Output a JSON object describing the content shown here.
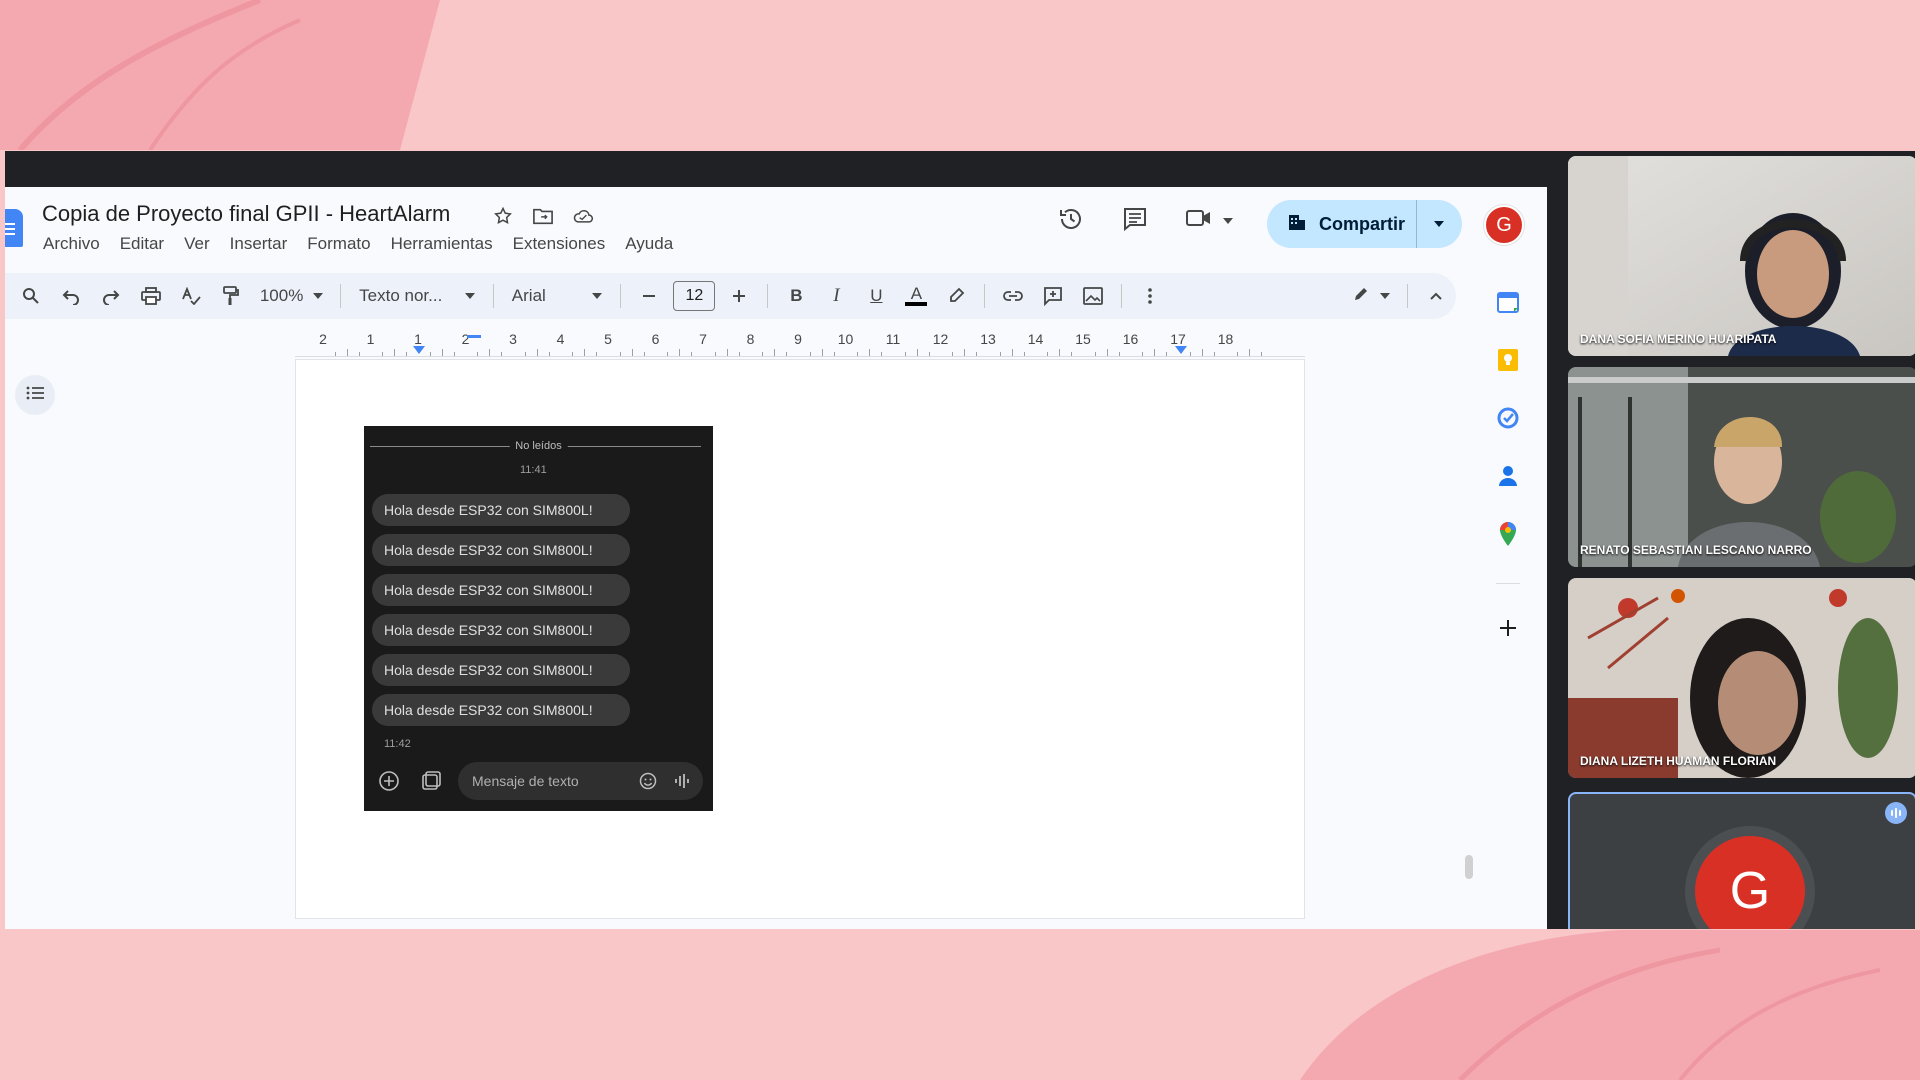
{
  "document": {
    "title": "Copia de Proyecto final GPII - HeartAlarm",
    "menu": [
      "Archivo",
      "Editar",
      "Ver",
      "Insertar",
      "Formato",
      "Herramientas",
      "Extensiones",
      "Ayuda"
    ],
    "share_label": "Compartir",
    "account_initial": "G"
  },
  "toolbar": {
    "zoom": "100%",
    "style": "Texto nor...",
    "font": "Arial",
    "font_size": "12",
    "bold": "B",
    "italic": "I",
    "underline": "U",
    "text_color": "A"
  },
  "ruler": {
    "labels": [
      "2",
      "1",
      "1",
      "2",
      "3",
      "4",
      "5",
      "6",
      "7",
      "8",
      "9",
      "10",
      "11",
      "12",
      "13",
      "14",
      "15",
      "16",
      "17",
      "18"
    ]
  },
  "phone_screenshot": {
    "unread_label": "No leídos",
    "time_start": "11:41",
    "messages": [
      "Hola desde ESP32 con SIM800L!",
      "Hola desde ESP32 con SIM800L!",
      "Hola desde ESP32 con SIM800L!",
      "Hola desde ESP32 con SIM800L!",
      "Hola desde ESP32 con SIM800L!",
      "Hola desde ESP32 con SIM800L!"
    ],
    "time_end": "11:42",
    "compose_placeholder": "Mensaje de texto"
  },
  "side_panel_icons": [
    "calendar-icon",
    "keep-icon",
    "tasks-icon",
    "contacts-icon",
    "maps-icon",
    "add-icon"
  ],
  "participants": [
    {
      "name": "DANA SOFIA MERINO HUARIPATA",
      "colors": [
        "#e3e1de",
        "#c9c6c1"
      ]
    },
    {
      "name": "RENATO SEBASTIAN LESCANO NARRO",
      "colors": [
        "#5a5f5c",
        "#2e3330"
      ]
    },
    {
      "name": "DIANA LIZETH HUAMAN FLORIAN",
      "colors": [
        "#d6cfc8",
        "#8a3b2e"
      ]
    },
    {
      "initial": "G",
      "speaking": true
    }
  ]
}
